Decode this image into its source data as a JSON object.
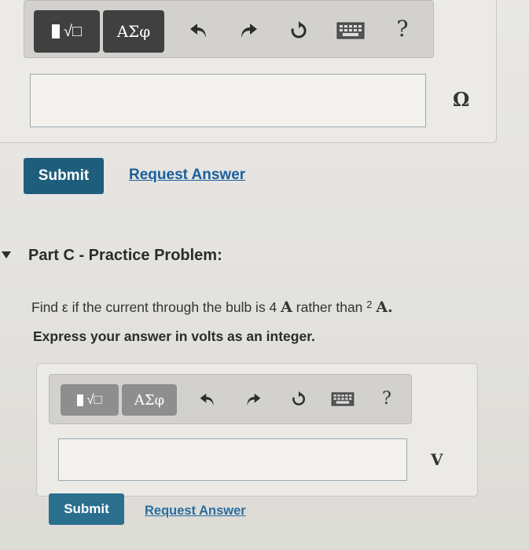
{
  "partB": {
    "toolbar": {
      "templates_label": "√□",
      "greek_label": "ΑΣφ",
      "undo_icon": "undo-icon",
      "redo_icon": "redo-icon",
      "reset_icon": "reset-icon",
      "keyboard_icon": "keyboard-icon",
      "help_label": "?"
    },
    "answer_value": "",
    "unit": "Ω",
    "submit_label": "Submit",
    "request_answer_label": "Request Answer"
  },
  "partC": {
    "title": "Part C - Practice Problem:",
    "question_prefix": "Find ε if the current through the bulb is 4 ",
    "question_unit1": "A",
    "question_mid": " rather than ",
    "question_value2": "2",
    "question_unit2": "A.",
    "instruction": "Express your answer in volts as an integer.",
    "toolbar": {
      "templates_label": "√□",
      "greek_label": "ΑΣφ",
      "help_label": "?"
    },
    "answer_value": "",
    "unit": "V",
    "submit_label": "Submit",
    "request_answer_label": "Request Answer"
  },
  "colors": {
    "submit_bg": "#1f5d7d",
    "link": "#1a5f9c",
    "toolbar_dark": "#404040"
  }
}
